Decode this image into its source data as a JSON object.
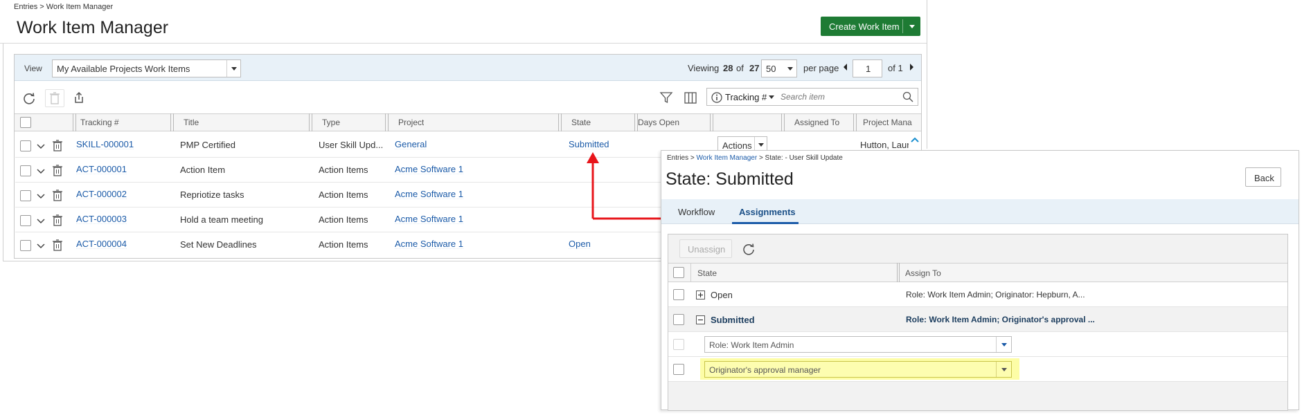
{
  "left": {
    "breadcrumb": "Entries > Work Item Manager",
    "page_title": "Work Item Manager",
    "create_button": "Create Work Item",
    "view_label": "View",
    "view_value": "My Available Projects Work Items",
    "viewing_prefix": "Viewing",
    "viewing_count": "28",
    "viewing_of": "of",
    "viewing_total": "27",
    "per_page_value": "50",
    "per_page_label": "per page",
    "page_value": "1",
    "of_pages": "of 1",
    "search_field": "Tracking #",
    "search_placeholder": "Search item",
    "columns": [
      "Tracking #",
      "Title",
      "Type",
      "Project",
      "State",
      "Days Open",
      "",
      "Assigned To",
      "Project Mana"
    ],
    "rows": [
      {
        "tracking": "SKILL-000001",
        "title": "PMP Certified",
        "type": "User Skill Upd...",
        "project": "General",
        "state": "Submitted",
        "actions": "Actions",
        "project_manager": "Hutton, Laur"
      },
      {
        "tracking": "ACT-000001",
        "title": "Action Item",
        "type": "Action Items",
        "project": "Acme Software 1",
        "state": ""
      },
      {
        "tracking": "ACT-000002",
        "title": "Repriotize tasks",
        "type": "Action Items",
        "project": "Acme Software 1",
        "state": ""
      },
      {
        "tracking": "ACT-000003",
        "title": "Hold a team meeting",
        "type": "Action Items",
        "project": "Acme Software 1",
        "state": ""
      },
      {
        "tracking": "ACT-000004",
        "title": "Set New Deadlines",
        "type": "Action Items",
        "project": "Acme Software 1",
        "state": "Open"
      }
    ]
  },
  "right": {
    "breadcrumb_start": "Entries >",
    "breadcrumb_link": "Work Item Manager",
    "breadcrumb_end": "> State: - User Skill Update",
    "title": "State: Submitted",
    "back_button": "Back",
    "tabs": [
      "Workflow",
      "Assignments"
    ],
    "unassign_button": "Unassign",
    "columns": [
      "State",
      "Assign To"
    ],
    "rows": [
      {
        "state": "Open",
        "assign_to": "Role: Work Item Admin; Originator: Hepburn, A...",
        "expander": "+"
      },
      {
        "state": "Submitted",
        "assign_to": "Role: Work Item Admin; Originator's approval ...",
        "expander": "−"
      }
    ],
    "dropdowns": [
      "Role: Work Item Admin",
      "Originator's approval manager"
    ]
  },
  "colors": {
    "accent_green": "#1e7b34",
    "link_blue": "#1a5aa8",
    "toolbar_bg": "#e8f1f8",
    "highlight_yellow": "#fdfda6",
    "arrow_red": "#e8151b"
  },
  "icons": [
    "refresh-icon",
    "trash-icon",
    "export-icon",
    "filter-icon",
    "columns-icon",
    "info-icon",
    "search-icon",
    "chevron-down-icon",
    "plus-box-icon",
    "minus-box-icon"
  ]
}
